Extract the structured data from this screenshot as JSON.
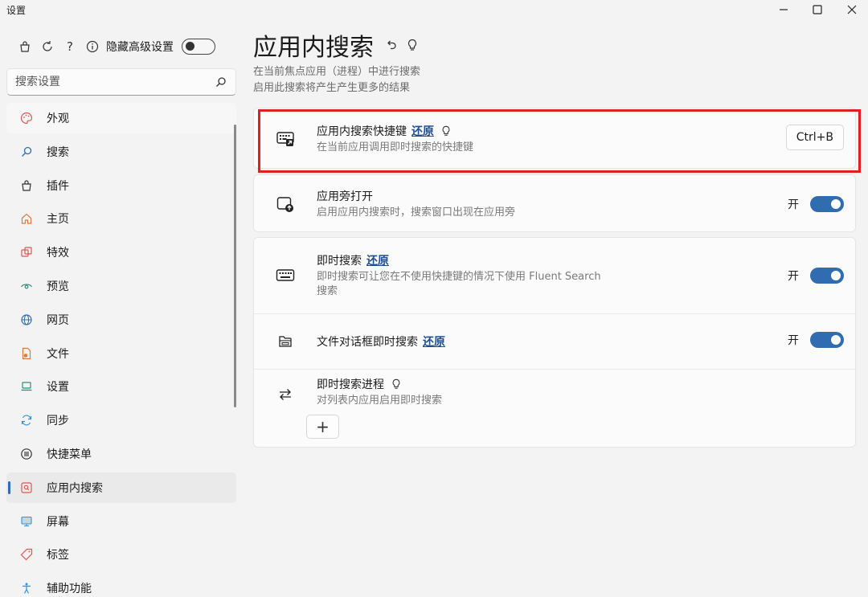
{
  "window": {
    "title": "设置",
    "min_icon": "minimize-icon",
    "max_icon": "maximize-icon",
    "close_icon": "close-icon"
  },
  "sidebar": {
    "top_icons": [
      "bag-icon",
      "refresh-icon",
      "help-icon",
      "info-icon"
    ],
    "advanced_label": "隐藏高级设置",
    "advanced_toggle": false,
    "search": {
      "placeholder": "搜索设置",
      "icon": "search-icon"
    },
    "items": [
      {
        "label": "外观",
        "icon": "palette-icon"
      },
      {
        "label": "搜索",
        "icon": "search-icon"
      },
      {
        "label": "插件",
        "icon": "plugin-bag-icon"
      },
      {
        "label": "主页",
        "icon": "home-icon"
      },
      {
        "label": "特效",
        "icon": "effects-icon"
      },
      {
        "label": "预览",
        "icon": "eye-icon"
      },
      {
        "label": "网页",
        "icon": "globe-icon"
      },
      {
        "label": "文件",
        "icon": "file-icon"
      },
      {
        "label": "设置",
        "icon": "laptop-icon"
      },
      {
        "label": "同步",
        "icon": "sync-icon"
      },
      {
        "label": "快捷菜单",
        "icon": "menu-icon"
      },
      {
        "label": "应用内搜索",
        "icon": "in-app-search-icon",
        "active": true
      },
      {
        "label": "屏幕",
        "icon": "screen-icon"
      },
      {
        "label": "标签",
        "icon": "tag-icon"
      },
      {
        "label": "辅助功能",
        "icon": "accessibility-icon"
      }
    ]
  },
  "main": {
    "title": "应用内搜索",
    "title_icons": [
      "undo-icon",
      "bulb-icon"
    ],
    "desc_line1": "在当前焦点应用（进程）中进行搜索",
    "desc_line2": "启用此搜索将产生产生更多的结果",
    "settings": {
      "hotkey": {
        "title": "应用内搜索快捷键",
        "restore": "还原",
        "subtitle": "在当前应用调用即时搜索的快捷键",
        "value": "Ctrl+B",
        "icon": "keyboard-shortcut-icon"
      },
      "side_open": {
        "title": "应用旁打开",
        "subtitle": "启用应用内搜索时，搜索窗口出现在应用旁",
        "state_label": "开",
        "enabled": true,
        "icon": "window-arrow-icon"
      },
      "instant": {
        "title": "即时搜索",
        "restore": "还原",
        "subtitle_line1": "即时搜索可让您在不使用快捷键的情况下使用 Fluent Search",
        "subtitle_line2": "搜索",
        "state_label": "开",
        "enabled": true,
        "icon": "keyboard-icon"
      },
      "file_dialog": {
        "title": "文件对话框即时搜索",
        "restore": "还原",
        "state_label": "开",
        "enabled": true,
        "icon": "folder-icon"
      },
      "processes": {
        "title": "即时搜索进程",
        "subtitle": "对列表内应用启用即时搜索",
        "add_label": "+",
        "icon": "swap-arrows-icon"
      }
    }
  },
  "colors": {
    "accent": "#2f6db0",
    "highlight": "#e0201e",
    "link": "#1f4f8f"
  }
}
